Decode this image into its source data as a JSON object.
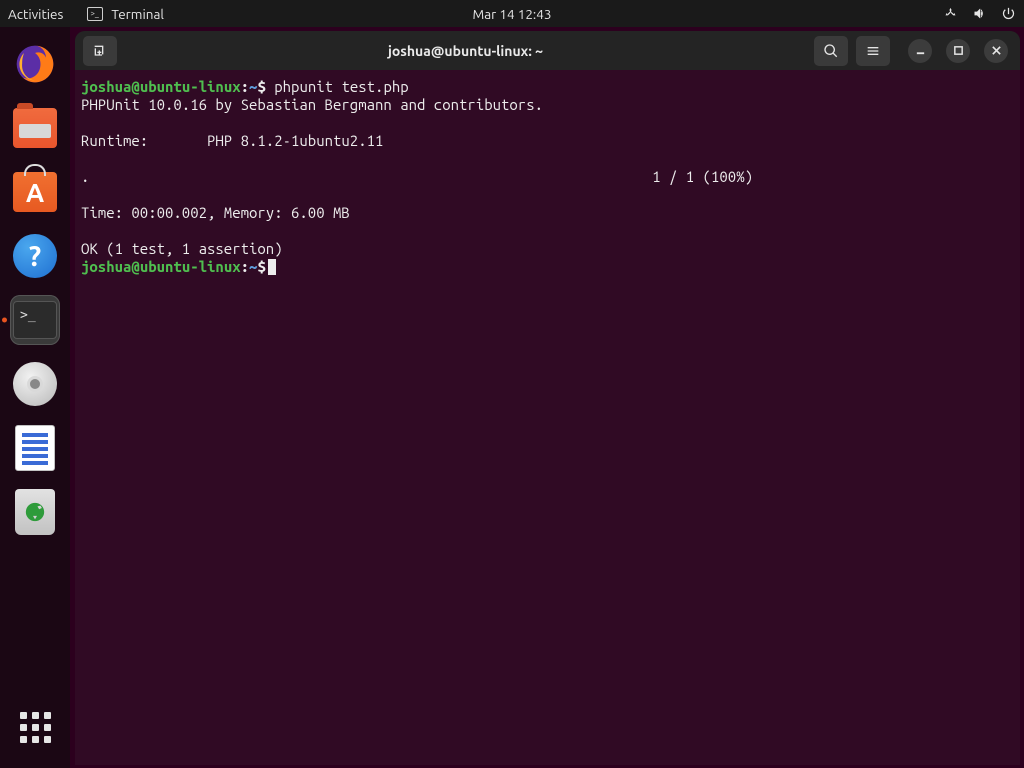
{
  "topbar": {
    "activities": "Activities",
    "app_indicator": "Terminal",
    "clock": "Mar 14  12:43"
  },
  "dock": {
    "items": [
      {
        "name": "firefox"
      },
      {
        "name": "files"
      },
      {
        "name": "software-center"
      },
      {
        "name": "help"
      },
      {
        "name": "terminal"
      },
      {
        "name": "disk"
      },
      {
        "name": "text-editor"
      },
      {
        "name": "trash"
      }
    ]
  },
  "window": {
    "title": "joshua@ubuntu-linux: ~"
  },
  "terminal": {
    "prompt": {
      "user": "joshua",
      "at": "@",
      "host": "ubuntu-linux",
      "colon": ":",
      "path": "~",
      "dollar": "$"
    },
    "command1": " phpunit test.php",
    "out_line1": "PHPUnit 10.0.16 by Sebastian Bergmann and contributors.",
    "out_blank": "",
    "out_runtime": "Runtime:       PHP 8.1.2-1ubuntu2.11",
    "out_progress": ".                                                                   1 / 1 (100%)",
    "out_time": "Time: 00:00.002, Memory: 6.00 MB",
    "out_ok": "OK (1 test, 1 assertion)"
  }
}
